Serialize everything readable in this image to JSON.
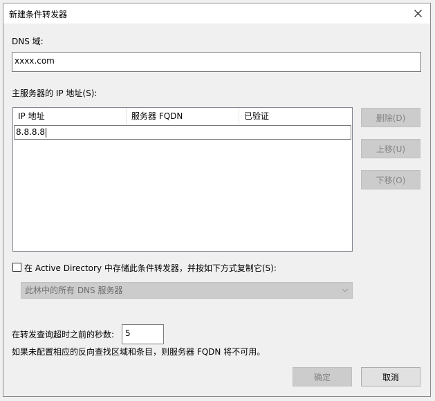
{
  "window": {
    "title": "新建条件转发器",
    "close_icon": "close-icon"
  },
  "dns_domain": {
    "label": "DNS 域:",
    "value": "xxxx.com"
  },
  "master_servers": {
    "label": "主服务器的 IP 地址(S):",
    "columns": [
      "IP 地址",
      "服务器 FQDN",
      "已验证"
    ],
    "editing_value": "8.8.8.8"
  },
  "side_buttons": {
    "delete": "删除(D)",
    "move_up": "上移(U)",
    "move_down": "下移(O)"
  },
  "store_in_ad": {
    "label": "在 Active Directory 中存储此条件转发器，并按如下方式复制它(S):",
    "checked": false
  },
  "replication_scope": {
    "selected": "此林中的所有 DNS 服务器",
    "enabled": false
  },
  "timeout": {
    "label": "在转发查询超时之前的秒数:",
    "value": "5"
  },
  "note": "如果未配置相应的反向查找区域和条目，则服务器 FQDN 将不可用。",
  "footer": {
    "ok": "确定",
    "cancel": "取消"
  },
  "colors": {
    "background": "#f0f0f0",
    "disabled_button": "#cccccc",
    "disabled_text": "#838383"
  }
}
